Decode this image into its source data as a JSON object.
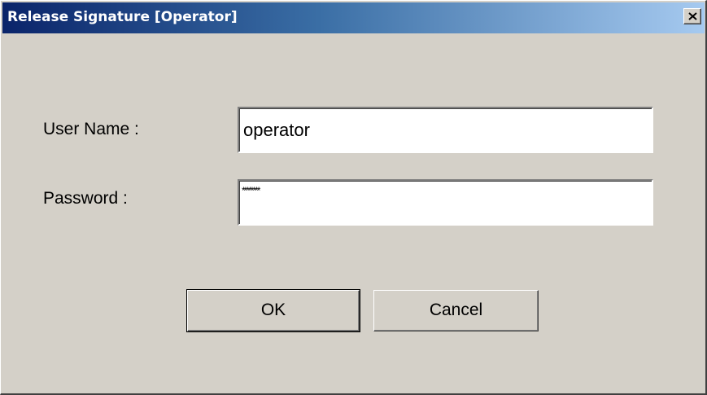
{
  "window": {
    "title": "Release Signature [Operator]",
    "close_icon": "close-x-icon"
  },
  "form": {
    "username_label": "User Name :",
    "username_value": "operator",
    "password_label": "Password :",
    "password_value": "********"
  },
  "buttons": {
    "ok_label": "OK",
    "cancel_label": "Cancel"
  },
  "colors": {
    "title_gradient_start": "#0a246a",
    "title_gradient_end": "#a6caf0",
    "dialog_face": "#d4d0c8"
  }
}
